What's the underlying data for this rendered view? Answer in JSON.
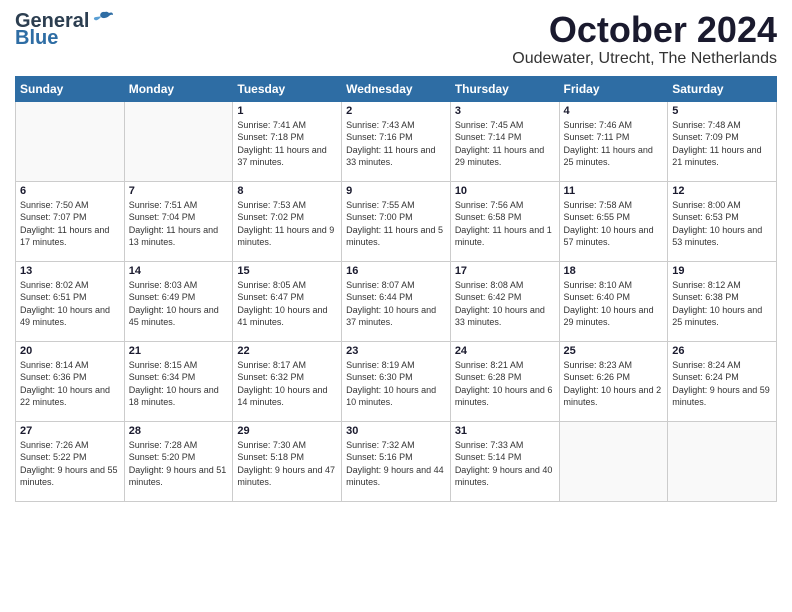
{
  "header": {
    "logo_general": "General",
    "logo_blue": "Blue",
    "month_title": "October 2024",
    "location": "Oudewater, Utrecht, The Netherlands"
  },
  "days_of_week": [
    "Sunday",
    "Monday",
    "Tuesday",
    "Wednesday",
    "Thursday",
    "Friday",
    "Saturday"
  ],
  "weeks": [
    [
      {
        "day": "",
        "empty": true
      },
      {
        "day": "",
        "empty": true
      },
      {
        "day": "1",
        "sunrise": "Sunrise: 7:41 AM",
        "sunset": "Sunset: 7:18 PM",
        "daylight": "Daylight: 11 hours and 37 minutes."
      },
      {
        "day": "2",
        "sunrise": "Sunrise: 7:43 AM",
        "sunset": "Sunset: 7:16 PM",
        "daylight": "Daylight: 11 hours and 33 minutes."
      },
      {
        "day": "3",
        "sunrise": "Sunrise: 7:45 AM",
        "sunset": "Sunset: 7:14 PM",
        "daylight": "Daylight: 11 hours and 29 minutes."
      },
      {
        "day": "4",
        "sunrise": "Sunrise: 7:46 AM",
        "sunset": "Sunset: 7:11 PM",
        "daylight": "Daylight: 11 hours and 25 minutes."
      },
      {
        "day": "5",
        "sunrise": "Sunrise: 7:48 AM",
        "sunset": "Sunset: 7:09 PM",
        "daylight": "Daylight: 11 hours and 21 minutes."
      }
    ],
    [
      {
        "day": "6",
        "sunrise": "Sunrise: 7:50 AM",
        "sunset": "Sunset: 7:07 PM",
        "daylight": "Daylight: 11 hours and 17 minutes."
      },
      {
        "day": "7",
        "sunrise": "Sunrise: 7:51 AM",
        "sunset": "Sunset: 7:04 PM",
        "daylight": "Daylight: 11 hours and 13 minutes."
      },
      {
        "day": "8",
        "sunrise": "Sunrise: 7:53 AM",
        "sunset": "Sunset: 7:02 PM",
        "daylight": "Daylight: 11 hours and 9 minutes."
      },
      {
        "day": "9",
        "sunrise": "Sunrise: 7:55 AM",
        "sunset": "Sunset: 7:00 PM",
        "daylight": "Daylight: 11 hours and 5 minutes."
      },
      {
        "day": "10",
        "sunrise": "Sunrise: 7:56 AM",
        "sunset": "Sunset: 6:58 PM",
        "daylight": "Daylight: 11 hours and 1 minute."
      },
      {
        "day": "11",
        "sunrise": "Sunrise: 7:58 AM",
        "sunset": "Sunset: 6:55 PM",
        "daylight": "Daylight: 10 hours and 57 minutes."
      },
      {
        "day": "12",
        "sunrise": "Sunrise: 8:00 AM",
        "sunset": "Sunset: 6:53 PM",
        "daylight": "Daylight: 10 hours and 53 minutes."
      }
    ],
    [
      {
        "day": "13",
        "sunrise": "Sunrise: 8:02 AM",
        "sunset": "Sunset: 6:51 PM",
        "daylight": "Daylight: 10 hours and 49 minutes."
      },
      {
        "day": "14",
        "sunrise": "Sunrise: 8:03 AM",
        "sunset": "Sunset: 6:49 PM",
        "daylight": "Daylight: 10 hours and 45 minutes."
      },
      {
        "day": "15",
        "sunrise": "Sunrise: 8:05 AM",
        "sunset": "Sunset: 6:47 PM",
        "daylight": "Daylight: 10 hours and 41 minutes."
      },
      {
        "day": "16",
        "sunrise": "Sunrise: 8:07 AM",
        "sunset": "Sunset: 6:44 PM",
        "daylight": "Daylight: 10 hours and 37 minutes."
      },
      {
        "day": "17",
        "sunrise": "Sunrise: 8:08 AM",
        "sunset": "Sunset: 6:42 PM",
        "daylight": "Daylight: 10 hours and 33 minutes."
      },
      {
        "day": "18",
        "sunrise": "Sunrise: 8:10 AM",
        "sunset": "Sunset: 6:40 PM",
        "daylight": "Daylight: 10 hours and 29 minutes."
      },
      {
        "day": "19",
        "sunrise": "Sunrise: 8:12 AM",
        "sunset": "Sunset: 6:38 PM",
        "daylight": "Daylight: 10 hours and 25 minutes."
      }
    ],
    [
      {
        "day": "20",
        "sunrise": "Sunrise: 8:14 AM",
        "sunset": "Sunset: 6:36 PM",
        "daylight": "Daylight: 10 hours and 22 minutes."
      },
      {
        "day": "21",
        "sunrise": "Sunrise: 8:15 AM",
        "sunset": "Sunset: 6:34 PM",
        "daylight": "Daylight: 10 hours and 18 minutes."
      },
      {
        "day": "22",
        "sunrise": "Sunrise: 8:17 AM",
        "sunset": "Sunset: 6:32 PM",
        "daylight": "Daylight: 10 hours and 14 minutes."
      },
      {
        "day": "23",
        "sunrise": "Sunrise: 8:19 AM",
        "sunset": "Sunset: 6:30 PM",
        "daylight": "Daylight: 10 hours and 10 minutes."
      },
      {
        "day": "24",
        "sunrise": "Sunrise: 8:21 AM",
        "sunset": "Sunset: 6:28 PM",
        "daylight": "Daylight: 10 hours and 6 minutes."
      },
      {
        "day": "25",
        "sunrise": "Sunrise: 8:23 AM",
        "sunset": "Sunset: 6:26 PM",
        "daylight": "Daylight: 10 hours and 2 minutes."
      },
      {
        "day": "26",
        "sunrise": "Sunrise: 8:24 AM",
        "sunset": "Sunset: 6:24 PM",
        "daylight": "Daylight: 9 hours and 59 minutes."
      }
    ],
    [
      {
        "day": "27",
        "sunrise": "Sunrise: 7:26 AM",
        "sunset": "Sunset: 5:22 PM",
        "daylight": "Daylight: 9 hours and 55 minutes."
      },
      {
        "day": "28",
        "sunrise": "Sunrise: 7:28 AM",
        "sunset": "Sunset: 5:20 PM",
        "daylight": "Daylight: 9 hours and 51 minutes."
      },
      {
        "day": "29",
        "sunrise": "Sunrise: 7:30 AM",
        "sunset": "Sunset: 5:18 PM",
        "daylight": "Daylight: 9 hours and 47 minutes."
      },
      {
        "day": "30",
        "sunrise": "Sunrise: 7:32 AM",
        "sunset": "Sunset: 5:16 PM",
        "daylight": "Daylight: 9 hours and 44 minutes."
      },
      {
        "day": "31",
        "sunrise": "Sunrise: 7:33 AM",
        "sunset": "Sunset: 5:14 PM",
        "daylight": "Daylight: 9 hours and 40 minutes."
      },
      {
        "day": "",
        "empty": true
      },
      {
        "day": "",
        "empty": true
      }
    ]
  ]
}
